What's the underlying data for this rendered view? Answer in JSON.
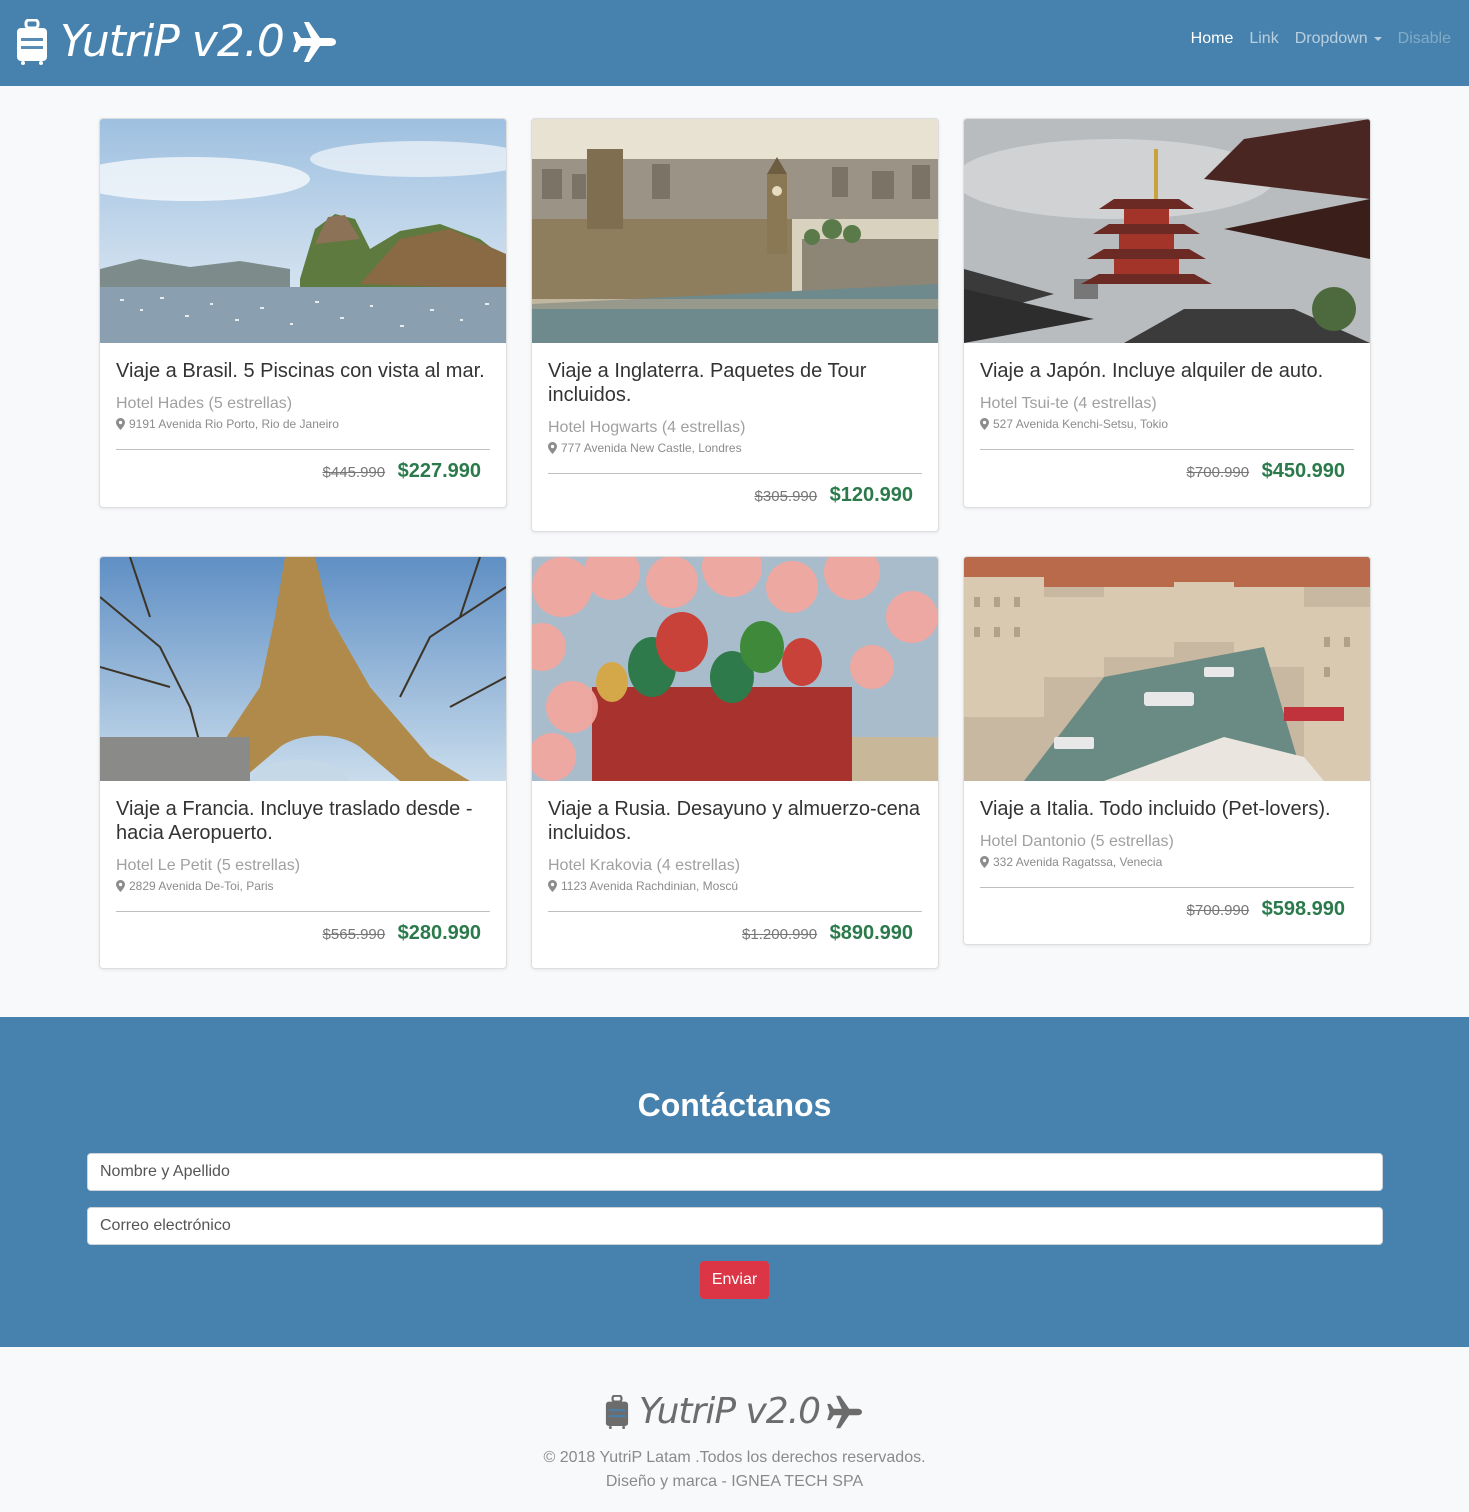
{
  "navbar": {
    "brand": "YutriP v2.0",
    "links": [
      {
        "label": "Home",
        "state": "active"
      },
      {
        "label": "Link",
        "state": "normal"
      },
      {
        "label": "Dropdown",
        "state": "dropdown"
      },
      {
        "label": "Disable",
        "state": "disabled"
      }
    ]
  },
  "cards": [
    {
      "title": "Viaje a Brasil. 5 Piscinas con vista al mar.",
      "hotel": "Hotel Hades (5 estrellas)",
      "address": "9191 Avenida Rio Porto, Rio de Janeiro",
      "old_price": "$445.990",
      "price": "$227.990",
      "image": "rio-de-janeiro-bay-photo"
    },
    {
      "title": "Viaje a Inglaterra. Paquetes de Tour incluidos.",
      "hotel": "Hotel Hogwarts (4 estrellas)",
      "address": "777 Avenida New Castle, Londres",
      "old_price": "$305.990",
      "price": "$120.990",
      "image": "london-westminster-photo"
    },
    {
      "title": "Viaje a Japón. Incluye alquiler de auto.",
      "hotel": "Hotel Tsui-te (4 estrellas)",
      "address": "527 Avenida Kenchi-Setsu, Tokio",
      "old_price": "$700.990",
      "price": "$450.990",
      "image": "japanese-pagoda-photo"
    },
    {
      "title": "Viaje a Francia. Incluye traslado desde - hacia Aeropuerto.",
      "hotel": "Hotel Le Petit (5 estrellas)",
      "address": "2829 Avenida De-Toi, Paris",
      "old_price": "$565.990",
      "price": "$280.990",
      "image": "eiffel-tower-photo"
    },
    {
      "title": "Viaje a Rusia. Desayuno y almuerzo-cena incluidos.",
      "hotel": "Hotel Krakovia (4 estrellas)",
      "address": "1123 Avenida Rachdinian, Moscú",
      "old_price": "$1.200.990",
      "price": "$890.990",
      "image": "moscow-cathedral-photo"
    },
    {
      "title": "Viaje a Italia. Todo incluido (Pet-lovers).",
      "hotel": "Hotel Dantonio (5 estrellas)",
      "address": "332 Avenida Ragatssa, Venecia",
      "old_price": "$700.990",
      "price": "$598.990",
      "image": "venice-canal-photo"
    }
  ],
  "contact": {
    "title": "Contáctanos",
    "name_placeholder": "Nombre y Apellido",
    "email_placeholder": "Correo electrónico",
    "submit_label": "Enviar"
  },
  "footer": {
    "brand": "YutriP v2.0",
    "copyright": "© 2018 YutriP Latam .Todos los derechos reservados.",
    "credits": "Diseño y marca - IGNEA TECH SPA"
  },
  "colors": {
    "primary": "#4682ad",
    "price_green": "#2b7a4b",
    "submit_red": "#dc3545"
  }
}
